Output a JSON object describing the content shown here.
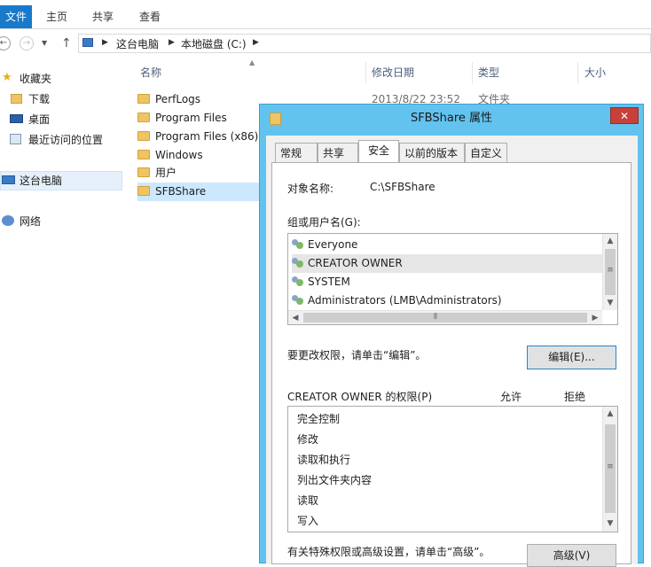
{
  "ribbon": {
    "file_tab": "文件",
    "tabs": [
      "主页",
      "共享",
      "查看"
    ]
  },
  "address": {
    "crumbs": [
      "这台电脑",
      "本地磁盘 (C:)"
    ]
  },
  "nav": {
    "favorites": "收藏夹",
    "items": [
      "下载",
      "桌面",
      "最近访问的位置"
    ],
    "this_pc": "这台电脑",
    "network": "网络"
  },
  "columns": {
    "name": "名称",
    "date": "修改日期",
    "type": "类型",
    "size": "大小"
  },
  "files": [
    {
      "name": "PerfLogs",
      "date": "2013/8/22 23:52",
      "type": "文件夹"
    },
    {
      "name": "Program Files"
    },
    {
      "name": "Program Files (x86)"
    },
    {
      "name": "Windows"
    },
    {
      "name": "用户"
    },
    {
      "name": "SFBShare"
    }
  ],
  "dialog": {
    "title": "SFBShare 属性",
    "close": "✕",
    "tabs": [
      "常规",
      "共享",
      "安全",
      "以前的版本",
      "自定义"
    ],
    "active_tab": "安全",
    "object_label": "对象名称:",
    "object_value": "C:\\SFBShare",
    "group_label": "组或用户名(G):",
    "users": [
      "Everyone",
      "CREATOR OWNER",
      "SYSTEM",
      "Administrators (LMB\\Administrators)"
    ],
    "selected_user": "CREATOR OWNER",
    "change_hint": "要更改权限，请单击“编辑”。",
    "edit_button": "编辑(E)...",
    "perm_title": "CREATOR OWNER 的权限(P)",
    "allow": "允许",
    "deny": "拒绝",
    "permissions": [
      "完全控制",
      "修改",
      "读取和执行",
      "列出文件夹内容",
      "读取",
      "写入"
    ],
    "advanced_hint": "有关特殊权限或高级设置，请单击“高级”。",
    "advanced_button": "高级(V)"
  }
}
